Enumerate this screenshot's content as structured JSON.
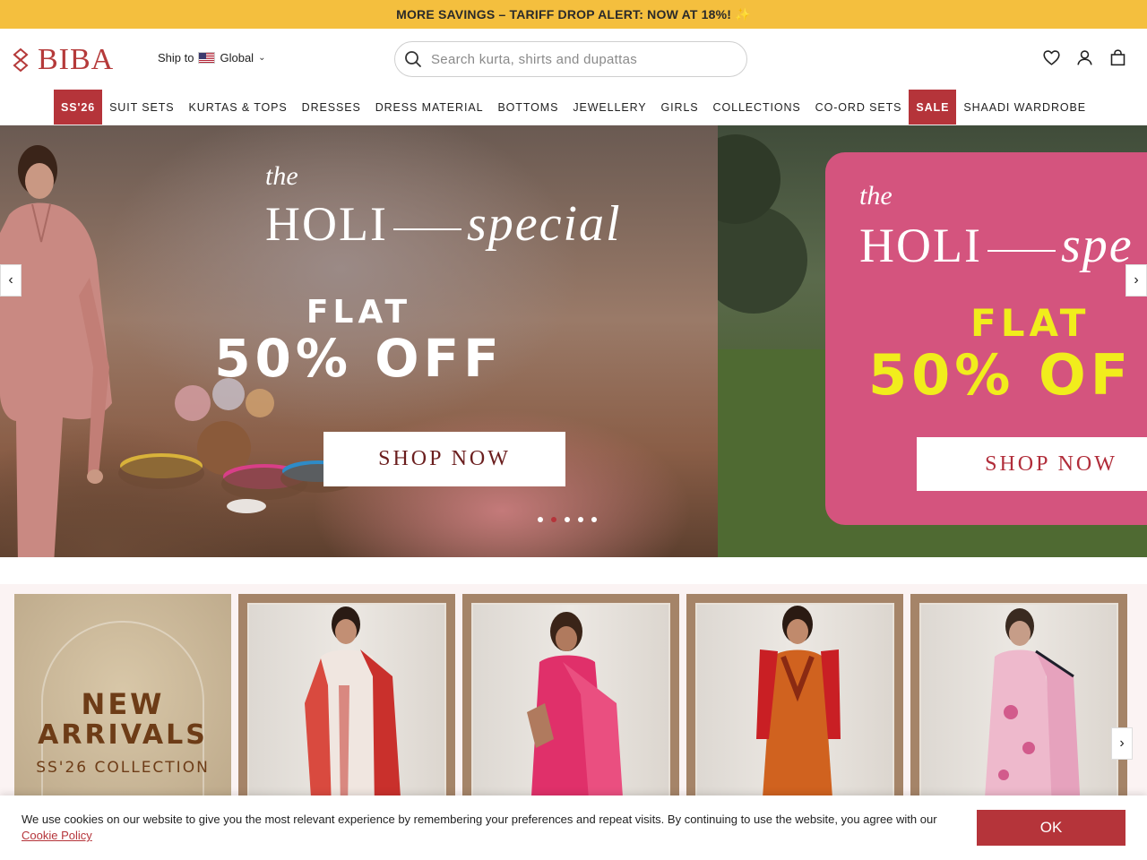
{
  "announcement": {
    "text": "MORE SAVINGS – TARIFF DROP ALERT: NOW AT 18%! ✨"
  },
  "header": {
    "logo_text": "BIBA",
    "ship_label": "Ship to",
    "ship_region": "Global",
    "search_placeholder": "Search kurta, shirts and dupattas",
    "icons": [
      "wishlist-heart-icon",
      "account-user-icon",
      "cart-bag-icon"
    ]
  },
  "nav": {
    "items": [
      {
        "label": "SS'26",
        "highlight": true
      },
      {
        "label": "SUIT SETS"
      },
      {
        "label": "KURTAS & TOPS"
      },
      {
        "label": "DRESSES"
      },
      {
        "label": "DRESS MATERIAL"
      },
      {
        "label": "BOTTOMS"
      },
      {
        "label": "JEWELLERY"
      },
      {
        "label": "GIRLS"
      },
      {
        "label": "COLLECTIONS"
      },
      {
        "label": "CO-ORD SETS"
      },
      {
        "label": "SALE",
        "highlight": true
      },
      {
        "label": "SHAADI WARDROBE"
      }
    ]
  },
  "hero": {
    "slides": [
      {
        "the": "the",
        "holi": "HOLI",
        "special": "special",
        "flat": "FLAT",
        "offer": "50% OFF",
        "cta": "SHOP NOW"
      },
      {
        "the": "the",
        "holi": "HOLI",
        "special": "spe",
        "flat": "FLAT",
        "offer": "50% OF",
        "cta": "SHOP NOW"
      }
    ],
    "dots_total": 5,
    "active_dot": 2
  },
  "categories": {
    "new_arrivals": {
      "line1": "NEW",
      "line2": "ARRIVALS",
      "line3": "SS'26 COLLECTION"
    }
  },
  "cookie": {
    "text": "We use cookies on our website to give you the most relevant experience by remembering your preferences and repeat visits. By continuing to use the website, you agree with our",
    "link": "Cookie Policy",
    "ok": "OK"
  },
  "colors": {
    "brand": "#b5343a",
    "announcement_bg": "#f4bf3e",
    "offer_yellow": "#f1ed1c",
    "pink_card": "#d4547e"
  }
}
